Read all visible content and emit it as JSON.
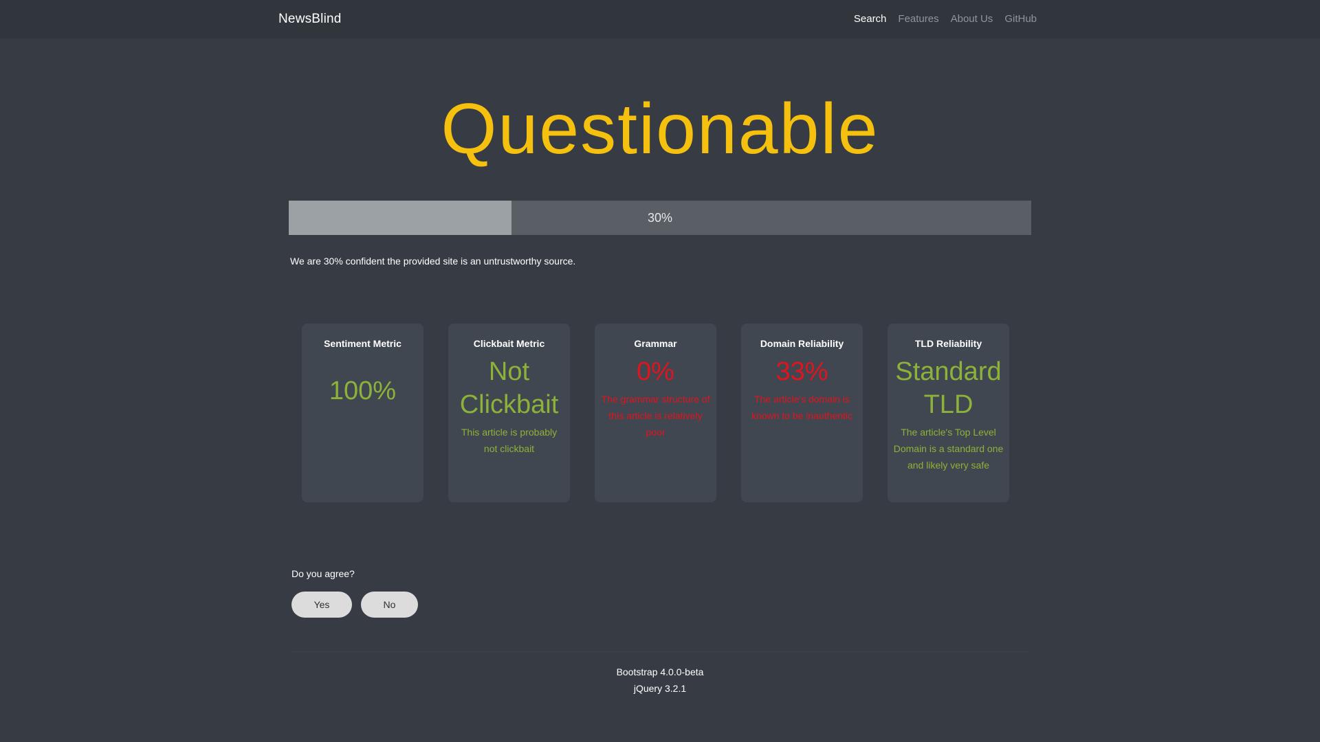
{
  "navbar": {
    "brand": "NewsBlind",
    "links": [
      {
        "label": "Search",
        "active": true
      },
      {
        "label": "Features",
        "active": false
      },
      {
        "label": "About Us",
        "active": false
      },
      {
        "label": "GitHub",
        "active": false
      }
    ]
  },
  "verdict": {
    "headline": "Questionable",
    "headline_color": "#f5c10e",
    "progress_value": 0.3,
    "progress_label": "30%",
    "confidence_text": "We are 30% confident the provided site is an untrustworthy source."
  },
  "metrics": [
    {
      "title": "Sentiment Metric",
      "value": "100%",
      "description": "",
      "status": "good"
    },
    {
      "title": "Clickbait Metric",
      "value": "Not Clickbait",
      "description": "This article is probably not clickbait",
      "status": "good"
    },
    {
      "title": "Grammar",
      "value": "0%",
      "description": "The grammar structure of this article is relatively poor",
      "status": "bad"
    },
    {
      "title": "Domain Reliability",
      "value": "33%",
      "description": "The article's domain is known to be inauthentic",
      "status": "bad"
    },
    {
      "title": "TLD Reliability",
      "value": "Standard TLD",
      "description": "The article's Top Level Domain is a standard one and likely very safe",
      "status": "good"
    }
  ],
  "feedback": {
    "question": "Do you agree?",
    "yes_label": "Yes",
    "no_label": "No"
  },
  "footer": {
    "line1": "Bootstrap 4.0.0-beta",
    "line2": "jQuery 3.2.1"
  },
  "colors": {
    "good": "#8cb23a",
    "bad": "#e0141e",
    "background": "#373c44"
  }
}
